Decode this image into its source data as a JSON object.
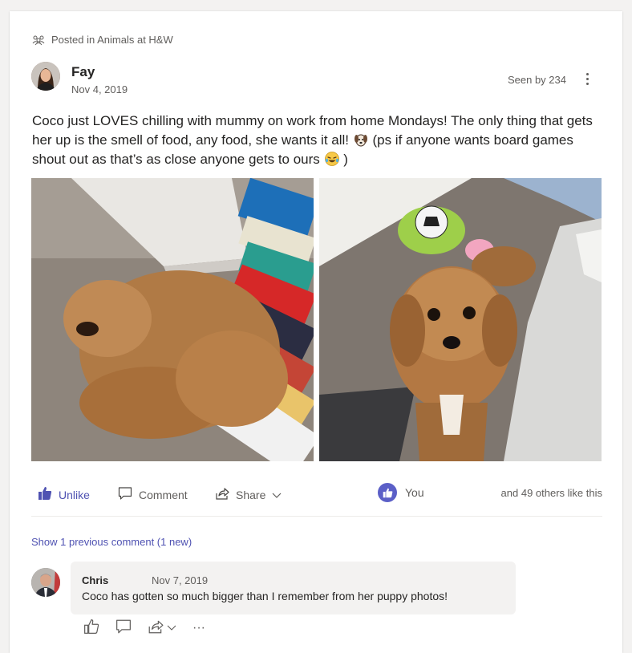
{
  "post": {
    "posted_in_prefix": "Posted in",
    "community": "Animals at H&W",
    "author": "Fay",
    "date": "Nov 4, 2019",
    "seen_by": "Seen by 234",
    "text_part1": "Coco just LOVES chilling with mummy on work from home Mondays! The only thing that gets her up is the smell of food, any food, she wants it all!",
    "text_part2": "(ps if anyone wants board games shout out as that’s as close anyone gets to ours",
    "text_part3": ")",
    "emojis": [
      "dog-face-emoji",
      "laughing-tears-emoji"
    ],
    "photos": [
      "dog-sleeping-by-board-games",
      "dog-looking-up"
    ]
  },
  "actions": {
    "unlike": "Unlike",
    "comment": "Comment",
    "share": "Share",
    "you": "You",
    "others": "and 49 others like this"
  },
  "comments": {
    "show_previous": "Show 1 previous comment (1 new)",
    "items": [
      {
        "author": "Chris",
        "date": "Nov 7, 2019",
        "text": "Coco has gotten so much bigger than I remember from her puppy photos!"
      }
    ],
    "more_label": "···"
  },
  "colors": {
    "accent": "#4f52b2",
    "like_badge": "#5b5fc7",
    "text": "#252423",
    "muted": "#605e5c",
    "bubble": "#f3f2f1"
  }
}
